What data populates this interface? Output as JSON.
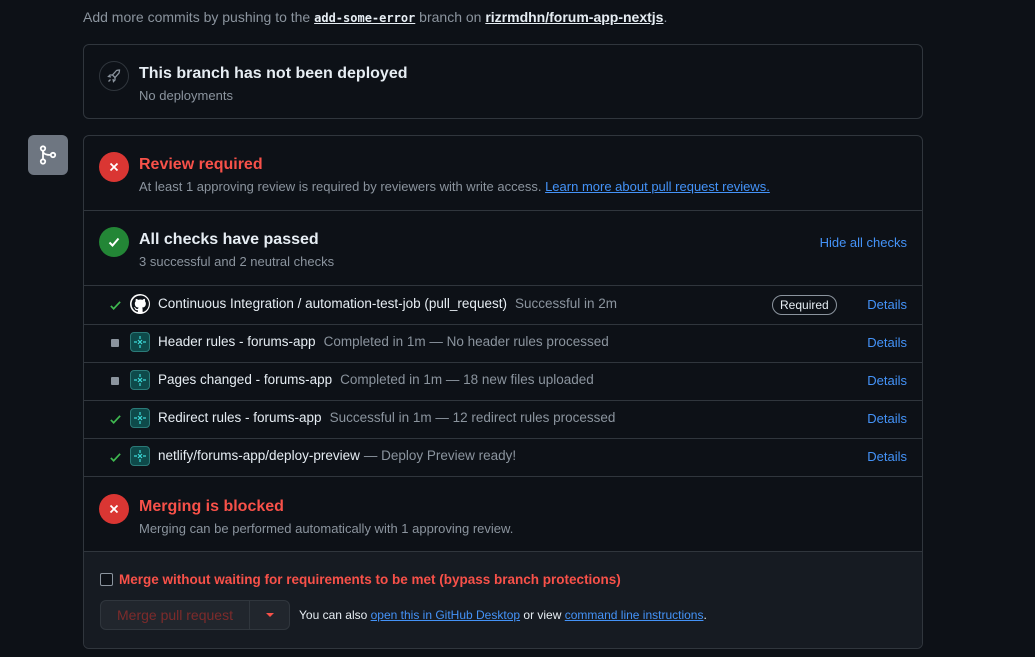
{
  "top_note": {
    "prefix": "Add more commits by pushing to the",
    "branch": "add-some-error",
    "middle": "branch on",
    "repo": "rizrmdhn/forum-app-nextjs",
    "suffix": "."
  },
  "deployment": {
    "icon": "rocket-icon",
    "title": "This branch has not been deployed",
    "subtitle": "No deployments"
  },
  "review": {
    "icon": "x-icon",
    "title": "Review required",
    "subtitle": "At least 1 approving review is required by reviewers with write access.",
    "link": "Learn more about pull request reviews."
  },
  "checks_summary": {
    "icon": "check-icon",
    "title": "All checks have passed",
    "subtitle": "3 successful and 2 neutral checks",
    "toggle": "Hide all checks"
  },
  "checks": [
    {
      "status": "success",
      "avatar": "github-icon",
      "name": "Continuous Integration / automation-test-job (pull_request)",
      "desc": "Successful in 2m",
      "badge": "Required",
      "action": "Details"
    },
    {
      "status": "neutral",
      "avatar": "netlify-icon",
      "name": "Header rules - forums-app",
      "desc": "Completed in 1m — No header rules processed",
      "action": "Details"
    },
    {
      "status": "neutral",
      "avatar": "netlify-icon",
      "name": "Pages changed - forums-app",
      "desc": "Completed in 1m — 18 new files uploaded",
      "action": "Details"
    },
    {
      "status": "success",
      "avatar": "netlify-icon",
      "name": "Redirect rules - forums-app",
      "desc": "Successful in 1m — 12 redirect rules processed",
      "action": "Details"
    },
    {
      "status": "success",
      "avatar": "netlify-icon",
      "name": "netlify/forums-app/deploy-preview",
      "desc": "— Deploy Preview ready!",
      "action": "Details"
    }
  ],
  "merging": {
    "icon": "x-icon",
    "title": "Merging is blocked",
    "subtitle": "Merging can be performed automatically with 1 approving review."
  },
  "bypass": {
    "label": "Merge without waiting for requirements to be met (bypass branch protections)",
    "checked": false
  },
  "merge_button": {
    "label": "Merge pull request"
  },
  "also": {
    "prefix": "You can also",
    "link1": "open this in GitHub Desktop",
    "middle": "or view",
    "link2": "command line instructions",
    "suffix": "."
  },
  "colors": {
    "background": "#0d1117",
    "border": "#30363d",
    "danger": "#f85149",
    "danger_circle": "#da3633",
    "success": "#238636",
    "success_check": "#3fb950",
    "link": "#4493f8",
    "muted": "#8b949e"
  }
}
